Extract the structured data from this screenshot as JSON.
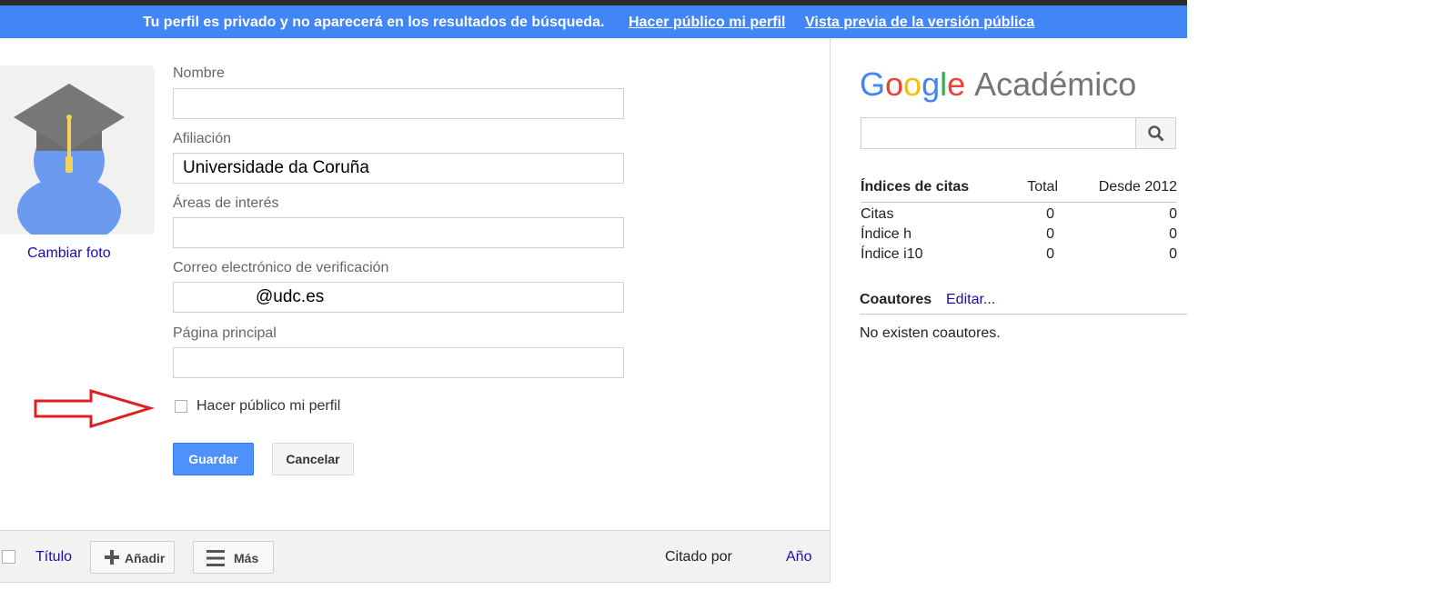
{
  "banner": {
    "message": "Tu perfil es privado y no aparecerá en los resultados de búsqueda.",
    "make_public_link": "Hacer público mi perfil",
    "preview_link": "Vista previa de la versión pública"
  },
  "profile": {
    "change_photo": "Cambiar foto",
    "fields": {
      "name": {
        "label": "Nombre",
        "value": ""
      },
      "affiliation": {
        "label": "Afiliación",
        "value": "Universidade da Coruña"
      },
      "interests": {
        "label": "Áreas de interés",
        "value": ""
      },
      "email": {
        "label": "Correo electrónico de verificación",
        "value": "@udc.es"
      },
      "homepage": {
        "label": "Página principal",
        "value": ""
      }
    },
    "make_public_checkbox": {
      "label": "Hacer público mi perfil",
      "checked": false
    },
    "save_label": "Guardar",
    "cancel_label": "Cancelar",
    "annotation_arrow_color": "#e02020"
  },
  "articles_toolbar": {
    "title_col": "Título",
    "add_label": "Añadir",
    "more_label": "Más",
    "cited_by": "Citado por",
    "year": "Año"
  },
  "sidebar": {
    "logo": {
      "google": "Google",
      "product": "Académico"
    },
    "search": {
      "placeholder": "",
      "icon": "search-icon"
    },
    "citations": {
      "header": [
        "Índices de citas",
        "Total",
        "Desde 2012"
      ],
      "rows": [
        {
          "label": "Citas",
          "total": "0",
          "since": "0"
        },
        {
          "label": "Índice h",
          "total": "0",
          "since": "0"
        },
        {
          "label": "Índice i10",
          "total": "0",
          "since": "0"
        }
      ]
    },
    "coauthors": {
      "title": "Coautores",
      "edit": "Editar...",
      "empty": "No existen coautores."
    }
  },
  "colors": {
    "banner": "#4285f4",
    "link": "#1a0dab",
    "primary_button": "#4d90fe"
  }
}
